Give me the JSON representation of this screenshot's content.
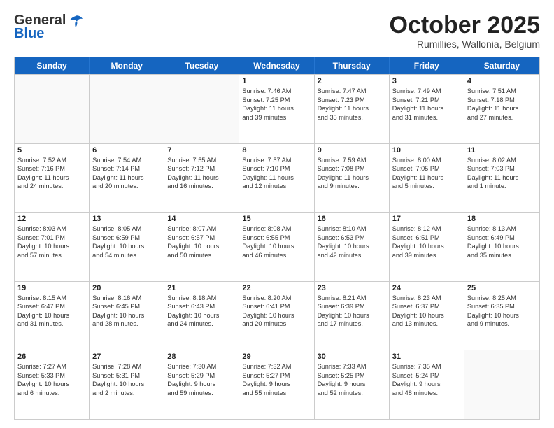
{
  "logo": {
    "general": "General",
    "blue": "Blue"
  },
  "title": "October 2025",
  "subtitle": "Rumillies, Wallonia, Belgium",
  "header_days": [
    "Sunday",
    "Monday",
    "Tuesday",
    "Wednesday",
    "Thursday",
    "Friday",
    "Saturday"
  ],
  "weeks": [
    [
      {
        "day": "",
        "lines": []
      },
      {
        "day": "",
        "lines": []
      },
      {
        "day": "",
        "lines": []
      },
      {
        "day": "1",
        "lines": [
          "Sunrise: 7:46 AM",
          "Sunset: 7:25 PM",
          "Daylight: 11 hours",
          "and 39 minutes."
        ]
      },
      {
        "day": "2",
        "lines": [
          "Sunrise: 7:47 AM",
          "Sunset: 7:23 PM",
          "Daylight: 11 hours",
          "and 35 minutes."
        ]
      },
      {
        "day": "3",
        "lines": [
          "Sunrise: 7:49 AM",
          "Sunset: 7:21 PM",
          "Daylight: 11 hours",
          "and 31 minutes."
        ]
      },
      {
        "day": "4",
        "lines": [
          "Sunrise: 7:51 AM",
          "Sunset: 7:18 PM",
          "Daylight: 11 hours",
          "and 27 minutes."
        ]
      }
    ],
    [
      {
        "day": "5",
        "lines": [
          "Sunrise: 7:52 AM",
          "Sunset: 7:16 PM",
          "Daylight: 11 hours",
          "and 24 minutes."
        ]
      },
      {
        "day": "6",
        "lines": [
          "Sunrise: 7:54 AM",
          "Sunset: 7:14 PM",
          "Daylight: 11 hours",
          "and 20 minutes."
        ]
      },
      {
        "day": "7",
        "lines": [
          "Sunrise: 7:55 AM",
          "Sunset: 7:12 PM",
          "Daylight: 11 hours",
          "and 16 minutes."
        ]
      },
      {
        "day": "8",
        "lines": [
          "Sunrise: 7:57 AM",
          "Sunset: 7:10 PM",
          "Daylight: 11 hours",
          "and 12 minutes."
        ]
      },
      {
        "day": "9",
        "lines": [
          "Sunrise: 7:59 AM",
          "Sunset: 7:08 PM",
          "Daylight: 11 hours",
          "and 9 minutes."
        ]
      },
      {
        "day": "10",
        "lines": [
          "Sunrise: 8:00 AM",
          "Sunset: 7:05 PM",
          "Daylight: 11 hours",
          "and 5 minutes."
        ]
      },
      {
        "day": "11",
        "lines": [
          "Sunrise: 8:02 AM",
          "Sunset: 7:03 PM",
          "Daylight: 11 hours",
          "and 1 minute."
        ]
      }
    ],
    [
      {
        "day": "12",
        "lines": [
          "Sunrise: 8:03 AM",
          "Sunset: 7:01 PM",
          "Daylight: 10 hours",
          "and 57 minutes."
        ]
      },
      {
        "day": "13",
        "lines": [
          "Sunrise: 8:05 AM",
          "Sunset: 6:59 PM",
          "Daylight: 10 hours",
          "and 54 minutes."
        ]
      },
      {
        "day": "14",
        "lines": [
          "Sunrise: 8:07 AM",
          "Sunset: 6:57 PM",
          "Daylight: 10 hours",
          "and 50 minutes."
        ]
      },
      {
        "day": "15",
        "lines": [
          "Sunrise: 8:08 AM",
          "Sunset: 6:55 PM",
          "Daylight: 10 hours",
          "and 46 minutes."
        ]
      },
      {
        "day": "16",
        "lines": [
          "Sunrise: 8:10 AM",
          "Sunset: 6:53 PM",
          "Daylight: 10 hours",
          "and 42 minutes."
        ]
      },
      {
        "day": "17",
        "lines": [
          "Sunrise: 8:12 AM",
          "Sunset: 6:51 PM",
          "Daylight: 10 hours",
          "and 39 minutes."
        ]
      },
      {
        "day": "18",
        "lines": [
          "Sunrise: 8:13 AM",
          "Sunset: 6:49 PM",
          "Daylight: 10 hours",
          "and 35 minutes."
        ]
      }
    ],
    [
      {
        "day": "19",
        "lines": [
          "Sunrise: 8:15 AM",
          "Sunset: 6:47 PM",
          "Daylight: 10 hours",
          "and 31 minutes."
        ]
      },
      {
        "day": "20",
        "lines": [
          "Sunrise: 8:16 AM",
          "Sunset: 6:45 PM",
          "Daylight: 10 hours",
          "and 28 minutes."
        ]
      },
      {
        "day": "21",
        "lines": [
          "Sunrise: 8:18 AM",
          "Sunset: 6:43 PM",
          "Daylight: 10 hours",
          "and 24 minutes."
        ]
      },
      {
        "day": "22",
        "lines": [
          "Sunrise: 8:20 AM",
          "Sunset: 6:41 PM",
          "Daylight: 10 hours",
          "and 20 minutes."
        ]
      },
      {
        "day": "23",
        "lines": [
          "Sunrise: 8:21 AM",
          "Sunset: 6:39 PM",
          "Daylight: 10 hours",
          "and 17 minutes."
        ]
      },
      {
        "day": "24",
        "lines": [
          "Sunrise: 8:23 AM",
          "Sunset: 6:37 PM",
          "Daylight: 10 hours",
          "and 13 minutes."
        ]
      },
      {
        "day": "25",
        "lines": [
          "Sunrise: 8:25 AM",
          "Sunset: 6:35 PM",
          "Daylight: 10 hours",
          "and 9 minutes."
        ]
      }
    ],
    [
      {
        "day": "26",
        "lines": [
          "Sunrise: 7:27 AM",
          "Sunset: 5:33 PM",
          "Daylight: 10 hours",
          "and 6 minutes."
        ]
      },
      {
        "day": "27",
        "lines": [
          "Sunrise: 7:28 AM",
          "Sunset: 5:31 PM",
          "Daylight: 10 hours",
          "and 2 minutes."
        ]
      },
      {
        "day": "28",
        "lines": [
          "Sunrise: 7:30 AM",
          "Sunset: 5:29 PM",
          "Daylight: 9 hours",
          "and 59 minutes."
        ]
      },
      {
        "day": "29",
        "lines": [
          "Sunrise: 7:32 AM",
          "Sunset: 5:27 PM",
          "Daylight: 9 hours",
          "and 55 minutes."
        ]
      },
      {
        "day": "30",
        "lines": [
          "Sunrise: 7:33 AM",
          "Sunset: 5:25 PM",
          "Daylight: 9 hours",
          "and 52 minutes."
        ]
      },
      {
        "day": "31",
        "lines": [
          "Sunrise: 7:35 AM",
          "Sunset: 5:24 PM",
          "Daylight: 9 hours",
          "and 48 minutes."
        ]
      },
      {
        "day": "",
        "lines": []
      }
    ]
  ]
}
